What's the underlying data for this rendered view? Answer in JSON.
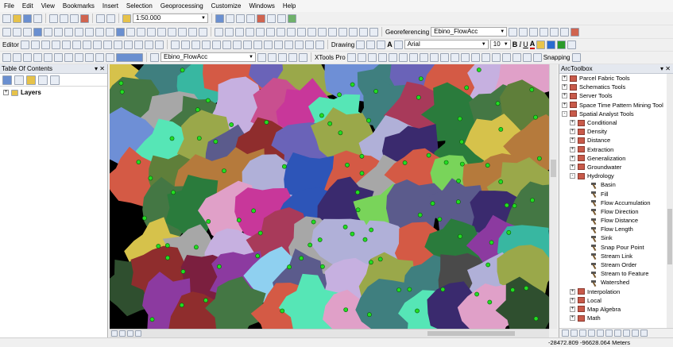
{
  "menu": [
    "File",
    "Edit",
    "View",
    "Bookmarks",
    "Insert",
    "Selection",
    "Geoprocessing",
    "Customize",
    "Windows",
    "Help"
  ],
  "toolbar": {
    "scale": "1:50.000",
    "georeferencing_label": "Georeferencing",
    "georef_layer": "Ebino_FlowAcc",
    "font_name": "Arial",
    "font_size": "10",
    "bold": "B",
    "italic": "I",
    "underline": "U",
    "font_color_letter": "A",
    "editor_label": "Editor",
    "drawing_label": "Drawing",
    "draw_text_letter": "A",
    "layer_combo": "Ebino_FlowAcc",
    "xtools_label": "XTools Pro",
    "snapping_label": "Snapping"
  },
  "toc": {
    "title": "Table Of Contents",
    "root_label": "Layers"
  },
  "arctoolbox": {
    "title": "ArcToolbox",
    "items": [
      {
        "label": "Parcel Fabric Tools",
        "kind": "toolbox",
        "level": 0,
        "expander": "+"
      },
      {
        "label": "Schematics Tools",
        "kind": "toolbox",
        "level": 0,
        "expander": "+"
      },
      {
        "label": "Server Tools",
        "kind": "toolbox",
        "level": 0,
        "expander": "+"
      },
      {
        "label": "Space Time Pattern Mining Tool",
        "kind": "toolbox",
        "level": 0,
        "expander": "+"
      },
      {
        "label": "Spatial Analyst Tools",
        "kind": "toolbox",
        "level": 0,
        "expander": "-"
      },
      {
        "label": "Conditional",
        "kind": "toolbox",
        "level": 1,
        "expander": "+"
      },
      {
        "label": "Density",
        "kind": "toolbox",
        "level": 1,
        "expander": "+"
      },
      {
        "label": "Distance",
        "kind": "toolbox",
        "level": 1,
        "expander": "+"
      },
      {
        "label": "Extraction",
        "kind": "toolbox",
        "level": 1,
        "expander": "+"
      },
      {
        "label": "Generalization",
        "kind": "toolbox",
        "level": 1,
        "expander": "+"
      },
      {
        "label": "Groundwater",
        "kind": "toolbox",
        "level": 1,
        "expander": "+"
      },
      {
        "label": "Hydrology",
        "kind": "toolbox",
        "level": 1,
        "expander": "-"
      },
      {
        "label": "Basin",
        "kind": "tool",
        "level": 2
      },
      {
        "label": "Fill",
        "kind": "tool",
        "level": 2
      },
      {
        "label": "Flow Accumulation",
        "kind": "tool",
        "level": 2
      },
      {
        "label": "Flow Direction",
        "kind": "tool",
        "level": 2
      },
      {
        "label": "Flow Distance",
        "kind": "tool",
        "level": 2
      },
      {
        "label": "Flow Length",
        "kind": "tool",
        "level": 2
      },
      {
        "label": "Sink",
        "kind": "tool",
        "level": 2
      },
      {
        "label": "Snap Pour Point",
        "kind": "tool",
        "level": 2
      },
      {
        "label": "Stream Link",
        "kind": "tool",
        "level": 2
      },
      {
        "label": "Stream Order",
        "kind": "tool",
        "level": 2
      },
      {
        "label": "Stream to Feature",
        "kind": "tool",
        "level": 2
      },
      {
        "label": "Watershed",
        "kind": "tool",
        "level": 2
      },
      {
        "label": "Interpolation",
        "kind": "toolbox",
        "level": 1,
        "expander": "+"
      },
      {
        "label": "Local",
        "kind": "toolbox",
        "level": 1,
        "expander": "+"
      },
      {
        "label": "Map Algebra",
        "kind": "toolbox",
        "level": 1,
        "expander": "+"
      },
      {
        "label": "Math",
        "kind": "toolbox",
        "level": 1,
        "expander": "+"
      }
    ]
  },
  "status": {
    "coordinates": "-28472.809  -96628.064 Meters"
  },
  "map": {
    "background": "#000000",
    "point_color": "#22dd22",
    "basin_palette": [
      "#c8379a",
      "#3a2a6e",
      "#5f7f3a",
      "#d6c24b",
      "#2a7b3c",
      "#8f2d2d",
      "#6a63b8",
      "#a7a7a7",
      "#c94f8f",
      "#6e8fd6",
      "#38b7a1",
      "#9aa84a",
      "#2d55b8",
      "#8c3aa0",
      "#79d45a",
      "#b57a3c",
      "#4a4a4a",
      "#e0a0c8",
      "#3f7f7f",
      "#9c6b52",
      "#56e6b6",
      "#7b1f3f",
      "#b0b0d8",
      "#2f4f2f",
      "#d45a45",
      "#8fd0f0",
      "#5b5b8c",
      "#c6b0e0",
      "#447744",
      "#a83a5a"
    ]
  }
}
